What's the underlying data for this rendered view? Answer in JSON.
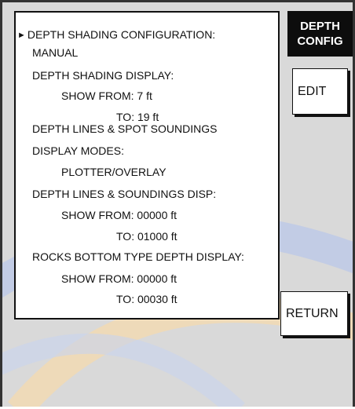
{
  "screen": {
    "title_line1": "DEPTH",
    "title_line2": "CONFIG",
    "cursor_symbol": "►"
  },
  "menu": {
    "item1_label": "DEPTH SHADING CONFIGURATION:",
    "item1_value": "MANUAL",
    "item2_label": "DEPTH SHADING DISPLAY:",
    "item2_from": "SHOW FROM: 7 ft",
    "item2_to": "TO: 19 ft",
    "item3_label_a": "DEPTH LINES & SPOT SOUNDINGS",
    "item3_label_b": "DISPLAY MODES:",
    "item3_value": "PLOTTER/OVERLAY",
    "item4_label": "DEPTH LINES & SOUNDINGS DISP:",
    "item4_from": "SHOW FROM: 00000 ft",
    "item4_to": "TO: 01000 ft",
    "item5_label": "ROCKS BOTTOM TYPE DEPTH DISPLAY:",
    "item5_from": "SHOW FROM: 00000 ft",
    "item5_to": "TO: 00030 ft"
  },
  "softkeys": {
    "edit_label": "EDIT",
    "return_label": "RETURN"
  },
  "colors": {
    "background": "#d9d9d9",
    "panel": "#ffffff",
    "title_bg": "#0d0d0d",
    "watermark_blue": "#b9c7e8",
    "watermark_orange": "#f2d9b0"
  }
}
